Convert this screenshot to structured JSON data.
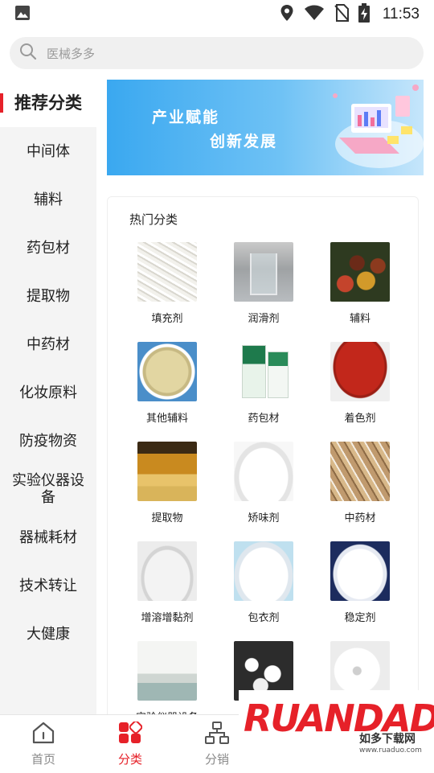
{
  "status_bar": {
    "time": "11:53"
  },
  "search": {
    "placeholder": "医械多多"
  },
  "sidebar": {
    "items": [
      {
        "label": "推荐分类",
        "active": true
      },
      {
        "label": "中间体"
      },
      {
        "label": "辅料"
      },
      {
        "label": "药包材"
      },
      {
        "label": "提取物"
      },
      {
        "label": "中药材"
      },
      {
        "label": "化妆原料"
      },
      {
        "label": "防疫物资"
      },
      {
        "label": "实验仪器设备"
      },
      {
        "label": "器械耗材"
      },
      {
        "label": "技术转让"
      },
      {
        "label": "大健康"
      }
    ]
  },
  "banner": {
    "line1": "产业赋能",
    "line2": "创新发展"
  },
  "hot": {
    "title": "热门分类",
    "items": [
      {
        "label": "填充剂",
        "icon": "rice-granules"
      },
      {
        "label": "润滑剂",
        "icon": "liquid-beaker"
      },
      {
        "label": "辅料",
        "icon": "colored-powders"
      },
      {
        "label": "其他辅料",
        "icon": "powder-dish"
      },
      {
        "label": "药包材",
        "icon": "medicine-box"
      },
      {
        "label": "着色剂",
        "icon": "red-pigment"
      },
      {
        "label": "提取物",
        "icon": "jars"
      },
      {
        "label": "矫味剂",
        "icon": "white-powder"
      },
      {
        "label": "中药材",
        "icon": "herb-roots"
      },
      {
        "label": "增溶增黏剂",
        "icon": "white-granules"
      },
      {
        "label": "包衣剂",
        "icon": "white-powder-pile"
      },
      {
        "label": "稳定剂",
        "icon": "white-powder-blue"
      },
      {
        "label": "实验仪器设备",
        "icon": "lab-room"
      },
      {
        "label": "",
        "icon": "crystals"
      },
      {
        "label": "",
        "icon": "cotton-roll"
      }
    ]
  },
  "bottom_nav": {
    "items": [
      {
        "label": "首页",
        "icon": "home-icon"
      },
      {
        "label": "分类",
        "icon": "category-icon",
        "active": true
      },
      {
        "label": "分销",
        "icon": "network-icon"
      }
    ]
  },
  "watermark": {
    "text": "RUANDADO",
    "sub": "如多下载网",
    "url": "www.ruaduo.com"
  },
  "colors": {
    "accent": "#e62129",
    "sidebar_bg": "#f4f4f4"
  }
}
